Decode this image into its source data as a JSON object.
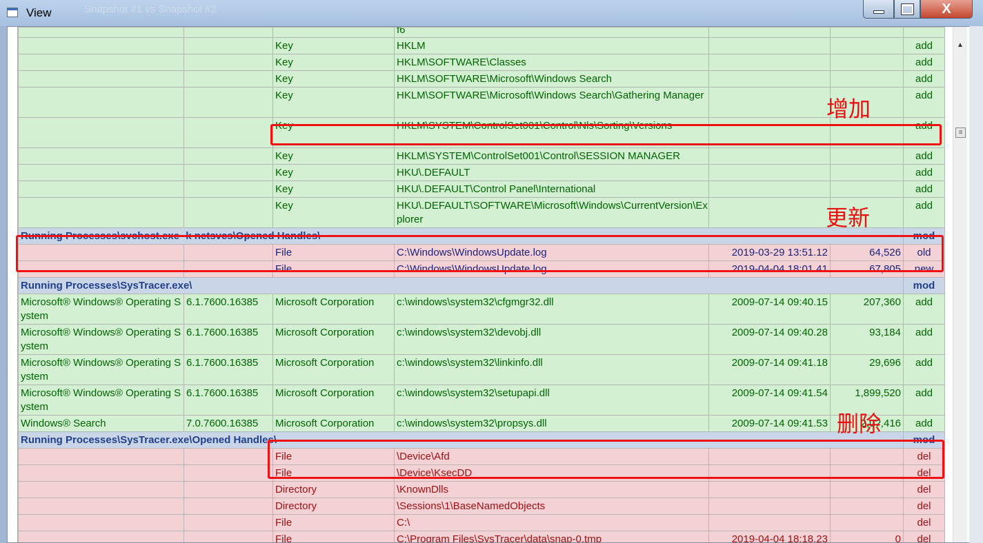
{
  "window": {
    "title": "View",
    "background_title": "Snapshot #1 vs Snapshot #2",
    "minimize_label": "",
    "maximize_label": "",
    "close_label": "X"
  },
  "top_partial": {
    "path": "f6"
  },
  "rows_add_keys": [
    {
      "type": "Key",
      "path": "HKLM",
      "status": "add"
    },
    {
      "type": "Key",
      "path": "HKLM\\SOFTWARE\\Classes",
      "status": "add"
    },
    {
      "type": "Key",
      "path": "HKLM\\SOFTWARE\\Microsoft\\Windows Search",
      "status": "add"
    },
    {
      "type": "Key",
      "path": "HKLM\\SOFTWARE\\Microsoft\\Windows Search\\Gathering Manager",
      "status": "add"
    },
    {
      "type": "Key",
      "path": "HKLM\\SYSTEM\\ControlSet001\\Control\\Nls\\Sorting\\Versions",
      "status": "add"
    },
    {
      "type": "Key",
      "path": "HKLM\\SYSTEM\\ControlSet001\\Control\\SESSION MANAGER",
      "status": "add"
    },
    {
      "type": "Key",
      "path": "HKU\\.DEFAULT",
      "status": "add"
    },
    {
      "type": "Key",
      "path": "HKU\\.DEFAULT\\Control Panel\\International",
      "status": "add"
    },
    {
      "type": "Key",
      "path": "HKU\\.DEFAULT\\SOFTWARE\\Microsoft\\Windows\\CurrentVersion\\Explorer",
      "status": "add"
    }
  ],
  "group1": {
    "label": "Running Processes\\svchost.exe -k netsvcs\\Opened Handles\\",
    "status": "mod"
  },
  "rows_mod": [
    {
      "type": "File",
      "path": "C:\\Windows\\WindowsUpdate.log",
      "date": "2019-03-29 13:51.12",
      "size": "64,526",
      "status": "old"
    },
    {
      "type": "File",
      "path": "C:\\Windows\\WindowsUpdate.log",
      "date": "2019-04-04 18:01.41",
      "size": "67,805",
      "status": "new"
    }
  ],
  "group2": {
    "label": "Running Processes\\SysTracer.exe\\",
    "status": "mod"
  },
  "rows_dll": [
    {
      "product": "Microsoft® Windows® Operating System",
      "version": "6.1.7600.16385",
      "company": "Microsoft Corporation",
      "path": "c:\\windows\\system32\\cfgmgr32.dll",
      "date": "2009-07-14 09:40.15",
      "size": "207,360",
      "status": "add"
    },
    {
      "product": "Microsoft® Windows® Operating System",
      "version": "6.1.7600.16385",
      "company": "Microsoft Corporation",
      "path": "c:\\windows\\system32\\devobj.dll",
      "date": "2009-07-14 09:40.28",
      "size": "93,184",
      "status": "add"
    },
    {
      "product": "Microsoft® Windows® Operating System",
      "version": "6.1.7600.16385",
      "company": "Microsoft Corporation",
      "path": "c:\\windows\\system32\\linkinfo.dll",
      "date": "2009-07-14 09:41.18",
      "size": "29,696",
      "status": "add"
    },
    {
      "product": "Microsoft® Windows® Operating System",
      "version": "6.1.7600.16385",
      "company": "Microsoft Corporation",
      "path": "c:\\windows\\system32\\setupapi.dll",
      "date": "2009-07-14 09:41.54",
      "size": "1,899,520",
      "status": "add"
    },
    {
      "product": "Windows® Search",
      "version": "7.0.7600.16385",
      "company": "Microsoft Corporation",
      "path": "c:\\windows\\system32\\propsys.dll",
      "date": "2009-07-14 09:41.53",
      "size": "2,0?,416",
      "status": "add"
    }
  ],
  "group3": {
    "label": "Running Processes\\SysTracer.exe\\Opened Handles\\",
    "status": "mod"
  },
  "rows_del": [
    {
      "type": "File",
      "path": "\\Device\\Afd",
      "date": "",
      "size": "",
      "status": "del"
    },
    {
      "type": "File",
      "path": "\\Device\\KsecDD",
      "date": "",
      "size": "",
      "status": "del"
    },
    {
      "type": "Directory",
      "path": "\\KnownDlls",
      "date": "",
      "size": "",
      "status": "del"
    },
    {
      "type": "Directory",
      "path": "\\Sessions\\1\\BaseNamedObjects",
      "date": "",
      "size": "",
      "status": "del"
    },
    {
      "type": "File",
      "path": "C:\\",
      "date": "",
      "size": "",
      "status": "del"
    },
    {
      "type": "File",
      "path": "C:\\Program Files\\SysTracer\\data\\snap-0.tmp",
      "date": "2019-04-04 18:18.23",
      "size": "0",
      "status": "del"
    }
  ],
  "annotations": {
    "add_note": "增加",
    "update_note": "更新",
    "delete_note": "删除",
    "highlight_color": "#ee1111"
  },
  "colors": {
    "add_bg": "#d3f0d3",
    "add_text": "#006400",
    "del_bg": "#f4d1d5",
    "del_text": "#9a1010",
    "group_bg": "#c9d6e8",
    "group_text": "#23408c"
  }
}
